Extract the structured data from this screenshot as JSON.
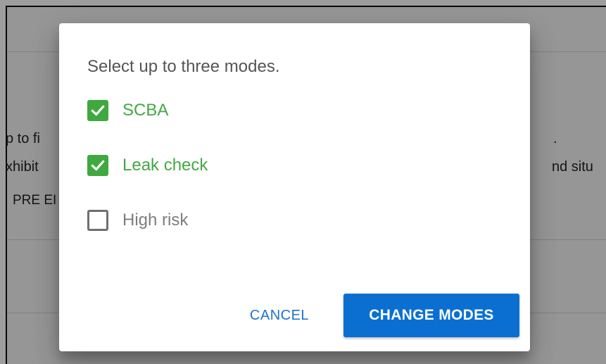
{
  "background": {
    "line1_left": "p to fi",
    "line1_right": ".",
    "line2_left": "xhibit",
    "line2_right": "nd situ",
    "line3_left": "PRE EI"
  },
  "dialog": {
    "prompt": "Select up to three modes.",
    "options": [
      {
        "label": "SCBA",
        "checked": true
      },
      {
        "label": "Leak check",
        "checked": true
      },
      {
        "label": "High risk",
        "checked": false
      }
    ],
    "cancel_label": "CANCEL",
    "confirm_label": "CHANGE MODES"
  },
  "colors": {
    "checked": "#3fa83f",
    "primary": "#0b6fd1",
    "cancel_text": "#1a73c9"
  },
  "icons": {
    "checked": "checkmark-icon"
  }
}
